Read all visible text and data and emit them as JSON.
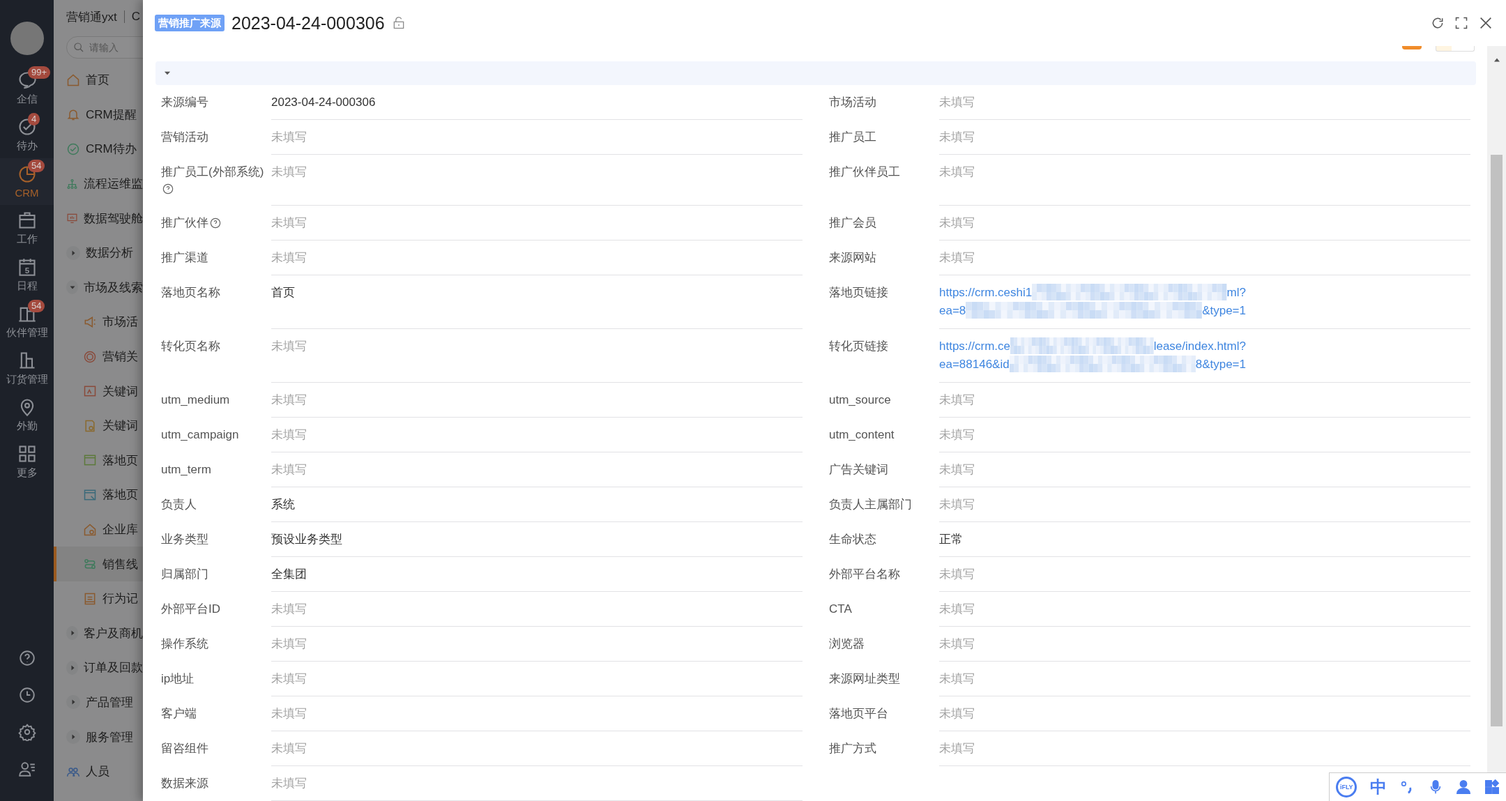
{
  "nav": {
    "items": [
      {
        "label": "企信",
        "badge": "99+",
        "selected": false
      },
      {
        "label": "待办",
        "badge": "4",
        "selected": false
      },
      {
        "label": "CRM",
        "badge": "54",
        "selected": true
      },
      {
        "label": "工作",
        "selected": false
      },
      {
        "label": "日程",
        "day": "5",
        "selected": false
      },
      {
        "label": "伙伴管理",
        "badge": "54",
        "selected": false
      },
      {
        "label": "订货管理",
        "selected": false
      },
      {
        "label": "外勤",
        "selected": false
      },
      {
        "label": "更多",
        "selected": false
      }
    ]
  },
  "menu": {
    "app_name": "营销通yxt",
    "app_name_cut": "C",
    "search": {
      "placeholder": "请输入"
    },
    "items": [
      {
        "label": "首页",
        "selected": false
      },
      {
        "label": "CRM提醒",
        "selected": false
      },
      {
        "label": "CRM待办",
        "selected": false
      },
      {
        "label": "流程运维监",
        "selected": false
      },
      {
        "label": "数据驾驶舱",
        "selected": false
      },
      {
        "label": "数据分析",
        "expanded": false
      },
      {
        "label": "市场及线索",
        "expanded": true,
        "children": [
          {
            "label": "市场活",
            "selected": false
          },
          {
            "label": "营销关",
            "selected": false
          },
          {
            "label": "关键词",
            "selected": false
          },
          {
            "label": "关键词",
            "selected": false
          },
          {
            "label": "落地页",
            "selected": false
          },
          {
            "label": "落地页",
            "selected": false
          },
          {
            "label": "企业库",
            "selected": false
          },
          {
            "label": "销售线",
            "selected": true
          },
          {
            "label": "行为记",
            "selected": false
          }
        ]
      },
      {
        "label": "客户及商机",
        "expanded": false
      },
      {
        "label": "订单及回款",
        "expanded": false
      },
      {
        "label": "产品管理",
        "expanded": false
      },
      {
        "label": "服务管理",
        "expanded": false
      },
      {
        "label": "人员",
        "selected": false
      }
    ]
  },
  "drawer": {
    "tag": "营销推广来源",
    "title": "2023-04-24-000306",
    "section": {
      "expanded": true
    },
    "fields": [
      {
        "label": "来源编号",
        "value": "2023-04-24-000306",
        "kind": "text"
      },
      {
        "label": "市场活动",
        "value": "未填写",
        "kind": "empty"
      },
      {
        "label": "营销活动",
        "value": "未填写",
        "kind": "empty"
      },
      {
        "label": "推广员工",
        "value": "未填写",
        "kind": "empty"
      },
      {
        "label": "推广员工(外部系统)",
        "help": true,
        "value": "未填写",
        "kind": "empty"
      },
      {
        "label": "推广伙伴员工",
        "value": "未填写",
        "kind": "empty"
      },
      {
        "label": "推广伙伴",
        "help": true,
        "value": "未填写",
        "kind": "empty"
      },
      {
        "label": "推广会员",
        "value": "未填写",
        "kind": "empty"
      },
      {
        "label": "推广渠道",
        "value": "未填写",
        "kind": "empty"
      },
      {
        "label": "来源网站",
        "value": "未填写",
        "kind": "empty"
      },
      {
        "label": "落地页名称",
        "value": "首页",
        "kind": "text"
      },
      {
        "label": "落地页链接",
        "kind": "link",
        "lines": [
          {
            "start": "https://crm.ceshi1",
            "end": "ml?"
          },
          {
            "start": "ea=8",
            "end": "&type=1"
          }
        ]
      },
      {
        "label": "转化页名称",
        "value": "未填写",
        "kind": "empty"
      },
      {
        "label": "转化页链接",
        "kind": "link",
        "lines": [
          {
            "start": "https://crm.ce",
            "end": "lease/index.html?"
          },
          {
            "start": "ea=88146&id",
            "end": "8&type=1"
          }
        ]
      },
      {
        "label": "utm_medium",
        "value": "未填写",
        "kind": "empty"
      },
      {
        "label": "utm_source",
        "value": "未填写",
        "kind": "empty"
      },
      {
        "label": "utm_campaign",
        "value": "未填写",
        "kind": "empty"
      },
      {
        "label": "utm_content",
        "value": "未填写",
        "kind": "empty"
      },
      {
        "label": "utm_term",
        "value": "未填写",
        "kind": "empty"
      },
      {
        "label": "广告关键词",
        "value": "未填写",
        "kind": "empty"
      },
      {
        "label": "负责人",
        "value": "系统",
        "kind": "text"
      },
      {
        "label": "负责人主属部门",
        "value": "未填写",
        "kind": "empty"
      },
      {
        "label": "业务类型",
        "value": "预设业务类型",
        "kind": "text"
      },
      {
        "label": "生命状态",
        "value": "正常",
        "kind": "text"
      },
      {
        "label": "归属部门",
        "value": "全集团",
        "kind": "text"
      },
      {
        "label": "外部平台名称",
        "value": "未填写",
        "kind": "empty"
      },
      {
        "label": "外部平台ID",
        "value": "未填写",
        "kind": "empty"
      },
      {
        "label": "CTA",
        "value": "未填写",
        "kind": "empty"
      },
      {
        "label": "操作系统",
        "value": "未填写",
        "kind": "empty"
      },
      {
        "label": "浏览器",
        "value": "未填写",
        "kind": "empty"
      },
      {
        "label": "ip地址",
        "value": "未填写",
        "kind": "empty"
      },
      {
        "label": "来源网址类型",
        "value": "未填写",
        "kind": "empty"
      },
      {
        "label": "客户端",
        "value": "未填写",
        "kind": "empty"
      },
      {
        "label": "落地页平台",
        "value": "未填写",
        "kind": "empty"
      },
      {
        "label": "留咨组件",
        "value": "未填写",
        "kind": "empty"
      },
      {
        "label": "推广方式",
        "value": "未填写",
        "kind": "empty"
      },
      {
        "label": "数据来源",
        "value": "未填写",
        "kind": "empty"
      }
    ]
  },
  "ime_bar": {
    "logo": "iFLY",
    "mode": "中"
  }
}
